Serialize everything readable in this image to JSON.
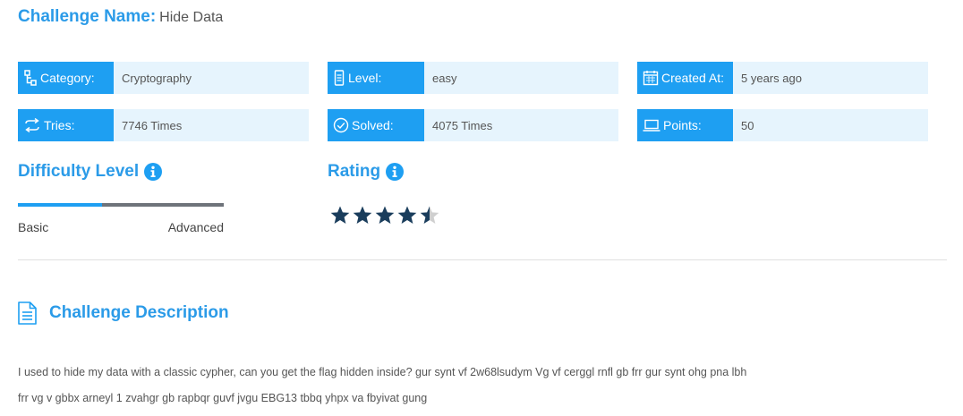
{
  "challenge": {
    "name_label": "Challenge Name:",
    "name": "Hide Data"
  },
  "info": {
    "category": {
      "label": "Category:",
      "value": "Cryptography",
      "icon": "sitemap-icon"
    },
    "level": {
      "label": "Level:",
      "value": "easy",
      "icon": "level-icon"
    },
    "created_at": {
      "label": "Created At:",
      "value": "5 years ago",
      "icon": "calendar-icon"
    },
    "tries": {
      "label": "Tries:",
      "value": "7746 Times",
      "icon": "exchange-icon"
    },
    "solved": {
      "label": "Solved:",
      "value": "4075 Times",
      "icon": "check-circle-icon"
    },
    "points": {
      "label": "Points:",
      "value": "50",
      "icon": "laptop-icon"
    }
  },
  "difficulty": {
    "title": "Difficulty Level",
    "basic_label": "Basic",
    "advanced_label": "Advanced",
    "level_fraction": 0.41
  },
  "rating": {
    "title": "Rating",
    "value": 4.5,
    "max": 5
  },
  "description": {
    "title": "Challenge Description",
    "line1": "I used to hide my data with a classic cypher, can you get the flag hidden inside? gur synt vf 2w68lsudym Vg vf cerggl rnfl gb frr gur synt ohg pna lbh",
    "line2": "frr vg v gbbx arneyl 1 zvahgr gb rapbqr guvf jvgu EBG13 tbbq yhpx va fbyivat gung"
  },
  "colors": {
    "accent": "#1e9ff2",
    "heading": "#2b9be8",
    "value_bg": "#e6f4fd",
    "star": "#1a3d5c",
    "star_empty": "#cfcfcf",
    "bar_empty": "#6e737a"
  }
}
